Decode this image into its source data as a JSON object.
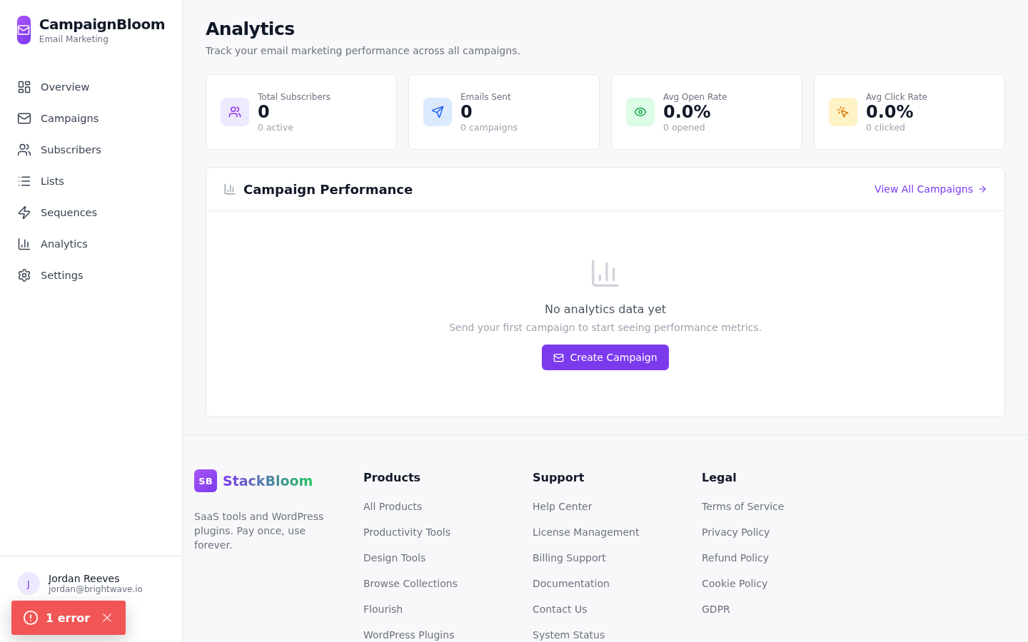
{
  "brand": {
    "name": "CampaignBloom",
    "tagline": "Email Marketing"
  },
  "nav": [
    {
      "label": "Overview"
    },
    {
      "label": "Campaigns"
    },
    {
      "label": "Subscribers"
    },
    {
      "label": "Lists"
    },
    {
      "label": "Sequences"
    },
    {
      "label": "Analytics"
    },
    {
      "label": "Settings"
    }
  ],
  "user": {
    "initial": "J",
    "name": "Jordan Reeves",
    "email": "jordan@brightwave.io"
  },
  "toast": {
    "text": "1 error"
  },
  "page": {
    "title": "Analytics",
    "subtitle": "Track your email marketing performance across all campaigns."
  },
  "stats": [
    {
      "label": "Total Subscribers",
      "value": "0",
      "note": "0 active",
      "color": "#9333ea"
    },
    {
      "label": "Emails Sent",
      "value": "0",
      "note": "0 campaigns",
      "color": "#2563eb"
    },
    {
      "label": "Avg Open Rate",
      "value": "0.0%",
      "note": "0 opened",
      "color": "#16a34a"
    },
    {
      "label": "Avg Click Rate",
      "value": "0.0%",
      "note": "0 clicked",
      "color": "#d97706"
    }
  ],
  "performance": {
    "title": "Campaign Performance",
    "link": "View All Campaigns",
    "empty_title": "No analytics data yet",
    "empty_text": "Send your first campaign to start seeing performance metrics.",
    "button": "Create Campaign"
  },
  "footer": {
    "logo_mark": "SB",
    "logo_name": "StackBloom",
    "blurb": "SaaS tools and WordPress plugins. Pay once, use forever.",
    "columns": [
      {
        "title": "Products",
        "links": [
          "All Products",
          "Productivity Tools",
          "Design Tools",
          "Browse Collections",
          "Flourish",
          "WordPress Plugins"
        ]
      },
      {
        "title": "Support",
        "links": [
          "Help Center",
          "License Management",
          "Billing Support",
          "Documentation",
          "Contact Us",
          "System Status"
        ]
      },
      {
        "title": "Legal",
        "links": [
          "Terms of Service",
          "Privacy Policy",
          "Refund Policy",
          "Cookie Policy",
          "GDPR"
        ]
      }
    ]
  }
}
